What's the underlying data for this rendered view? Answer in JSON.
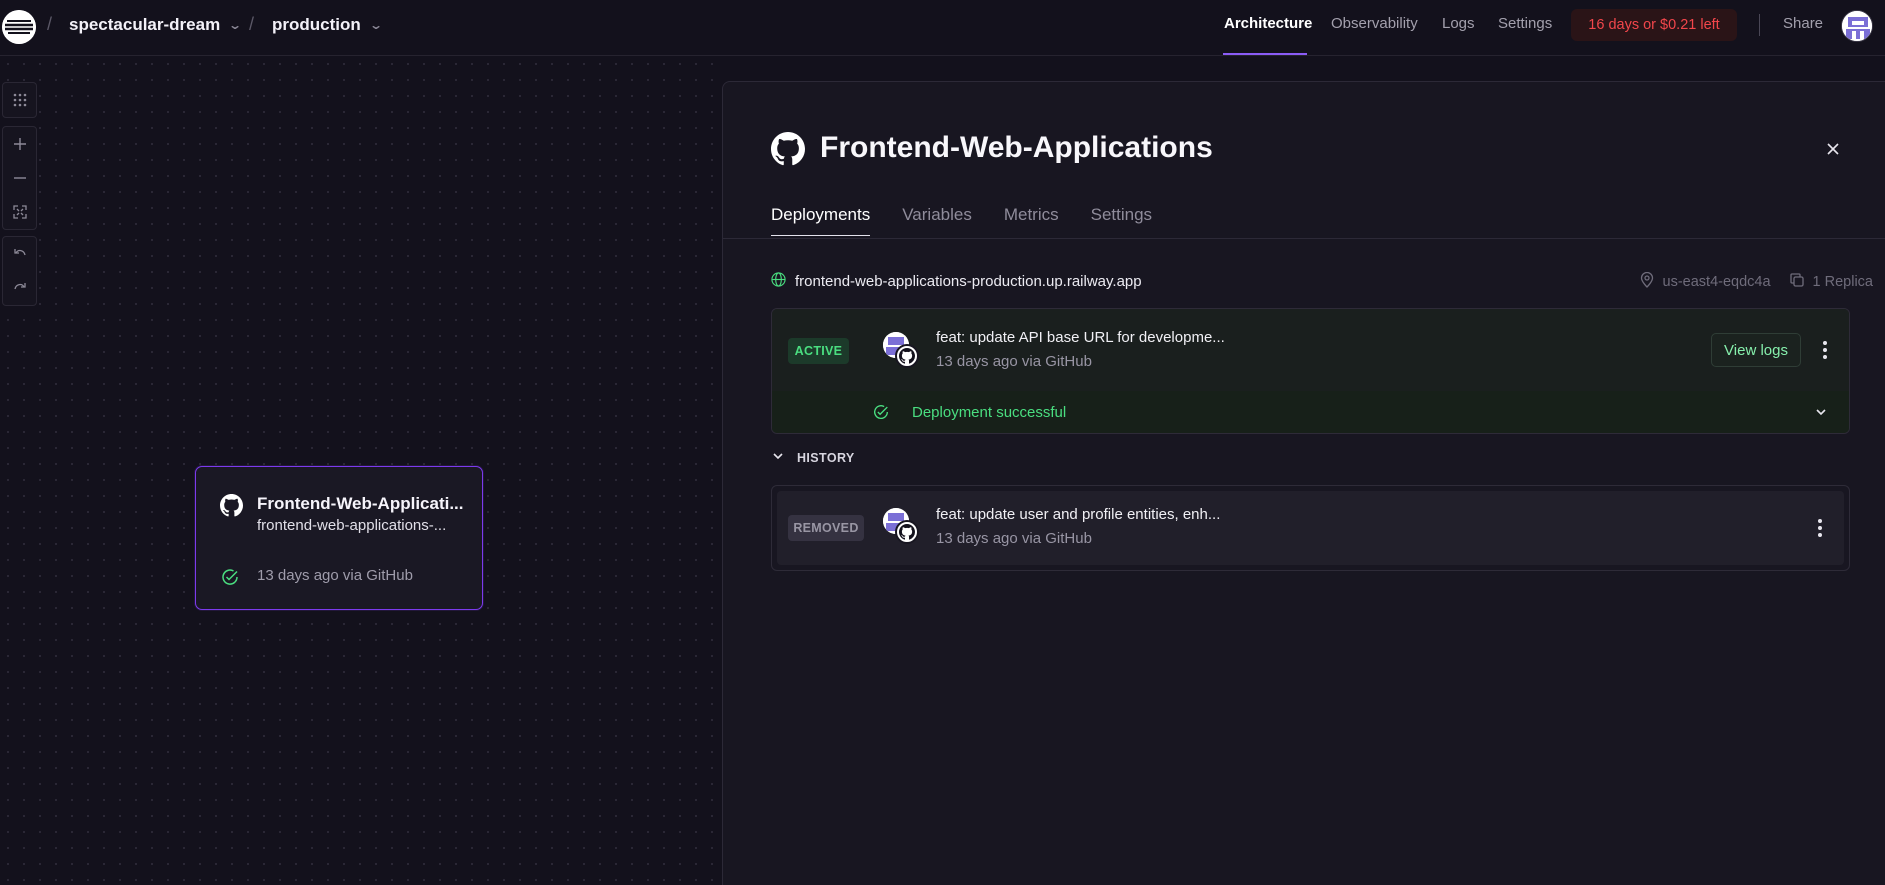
{
  "topbar": {
    "project": "spectacular-dream",
    "environment": "production",
    "nav": [
      "Architecture",
      "Observability",
      "Logs",
      "Settings"
    ],
    "active_nav": "Architecture",
    "trial": "16 days or $0.21 left",
    "share": "Share"
  },
  "canvas": {
    "tools": [
      "grid-icon",
      "plus-icon",
      "minus-icon",
      "fit-icon",
      "undo-icon",
      "redo-icon"
    ],
    "service_card": {
      "title": "Frontend-Web-Applicati...",
      "subtitle": "frontend-web-applications-...",
      "status": "13 days ago via GitHub"
    }
  },
  "panel": {
    "title": "Frontend-Web-Applications",
    "tabs": [
      "Deployments",
      "Variables",
      "Metrics",
      "Settings"
    ],
    "active_tab": "Deployments",
    "url": "frontend-web-applications-production.up.railway.app",
    "region": "us-east4-eqdc4a",
    "replicas": "1 Replica",
    "active_deployment": {
      "badge": "ACTIVE",
      "message": "feat: update API base URL for developme...",
      "meta": "13 days ago via GitHub",
      "view_logs": "View logs",
      "status": "Deployment successful"
    },
    "history_label": "HISTORY",
    "history": [
      {
        "badge": "REMOVED",
        "message": "feat: update user and profile entities, enh...",
        "meta": "13 days ago via GitHub"
      }
    ]
  },
  "colors": {
    "background": "#13111c",
    "accent": "#7c3aed",
    "success": "#4ade80",
    "danger": "#f2464b"
  }
}
